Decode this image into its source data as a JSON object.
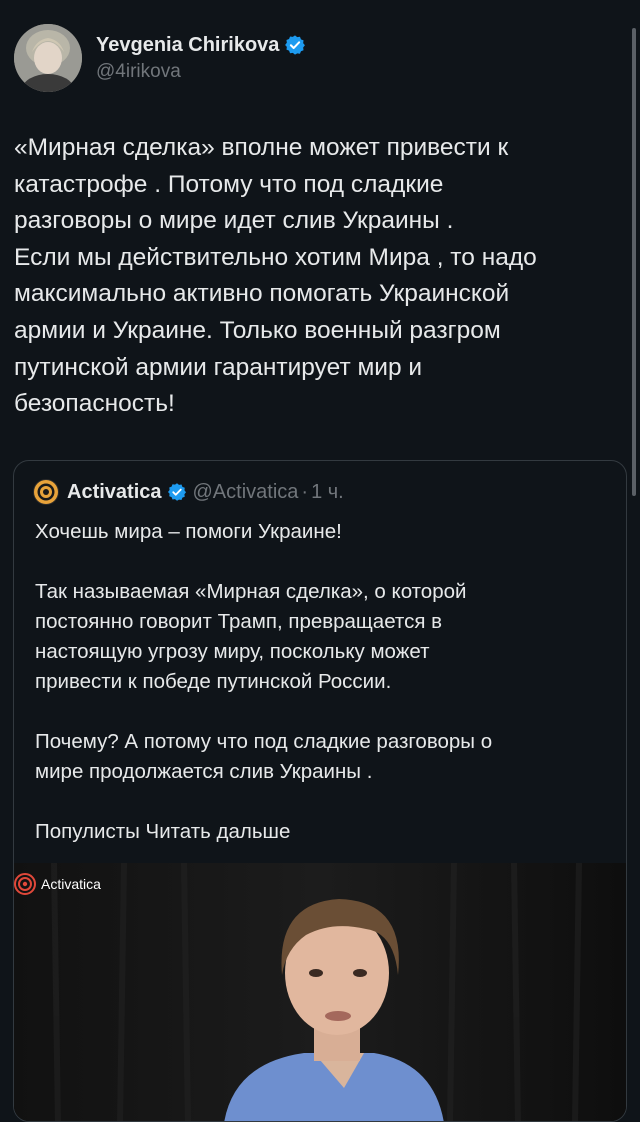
{
  "tweet": {
    "author_name": "Yevgenia Chirikova",
    "author_handle": "@4irikova",
    "text_lines": [
      "«Мирная сделка» вполне может привести к",
      "катастрофе . Потому что под сладкие",
      "разговоры о мире идет слив Украины .",
      "Если мы действительно хотим Мира , то надо",
      "максимально активно помогать Украинской",
      "армии и Украине. Только военный разгром",
      "путинской армии гарантирует мир и",
      "безопасность!"
    ]
  },
  "quote": {
    "author_name": "Activatica",
    "author_handle": "@Activatica",
    "separator": "·",
    "time": "1 ч.",
    "lines": {
      "p1": "Хочешь мира – помоги Украине!",
      "p2_1": "Так называемая «Мирная сделка», о которой",
      "p2_2": "постоянно говорит Трамп, превращается в",
      "p2_3": "настоящую угрозу миру, поскольку может",
      "p2_4": "привести к победе путинской России.",
      "p3_1": "Почему? А потому что под  сладкие разговоры о",
      "p3_2": "мире продолжается слив Украины .",
      "p4_prefix": "Популисты ",
      "p4_more": "Читать дальше"
    },
    "video_watermark": "Activatica"
  },
  "colors": {
    "background": "#0f1419",
    "text": "#e7e9ea",
    "secondary": "#71767b",
    "verified": "#1d9bf0",
    "border": "#333a40",
    "activatica_logo": "#e8a33a"
  },
  "icons": {
    "verified": "verified-badge-icon",
    "activatica_logo": "activatica-logo-icon"
  }
}
